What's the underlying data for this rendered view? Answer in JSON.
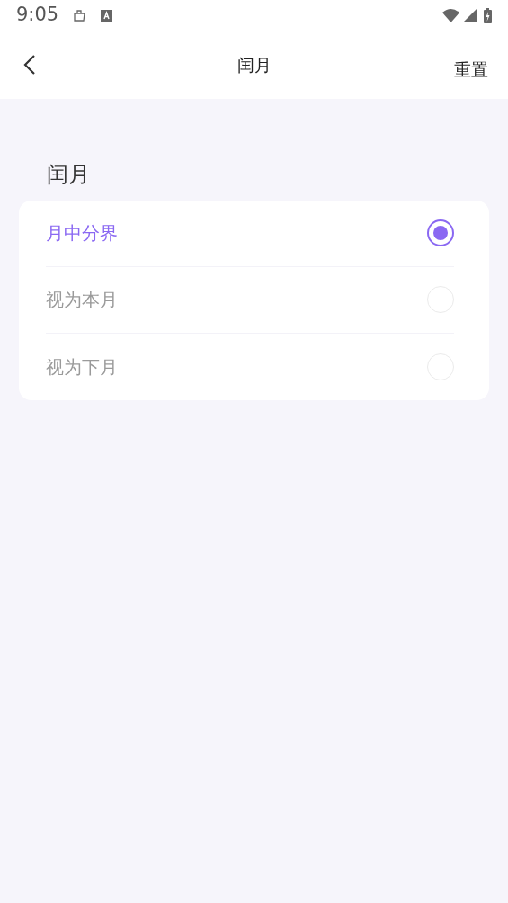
{
  "status_bar": {
    "time": "9:05"
  },
  "header": {
    "title": "闰月",
    "action": "重置"
  },
  "section": {
    "title": "闰月"
  },
  "options": [
    {
      "label": "月中分界",
      "selected": true
    },
    {
      "label": "视为本月",
      "selected": false
    },
    {
      "label": "视为下月",
      "selected": false
    }
  ]
}
